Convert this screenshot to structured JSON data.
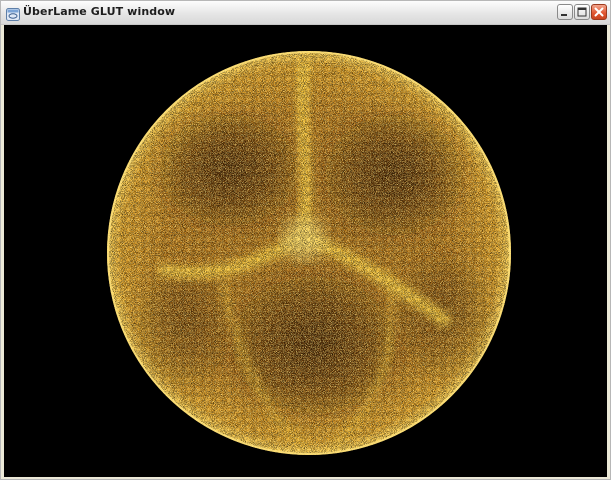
{
  "window": {
    "title": "ÜberLame GLUT window",
    "icon": "app-window-icon",
    "controls": {
      "minimize": "minimize-icon",
      "maximize": "maximize-icon",
      "close": "close-icon"
    }
  },
  "viewport": {
    "background_color": "#000000",
    "particle_color_bright": "#ffdd44",
    "particle_color_mid": "#e89a1a",
    "particle_color_dark": "#5a2c04",
    "rendering": "orange particle sphere"
  }
}
